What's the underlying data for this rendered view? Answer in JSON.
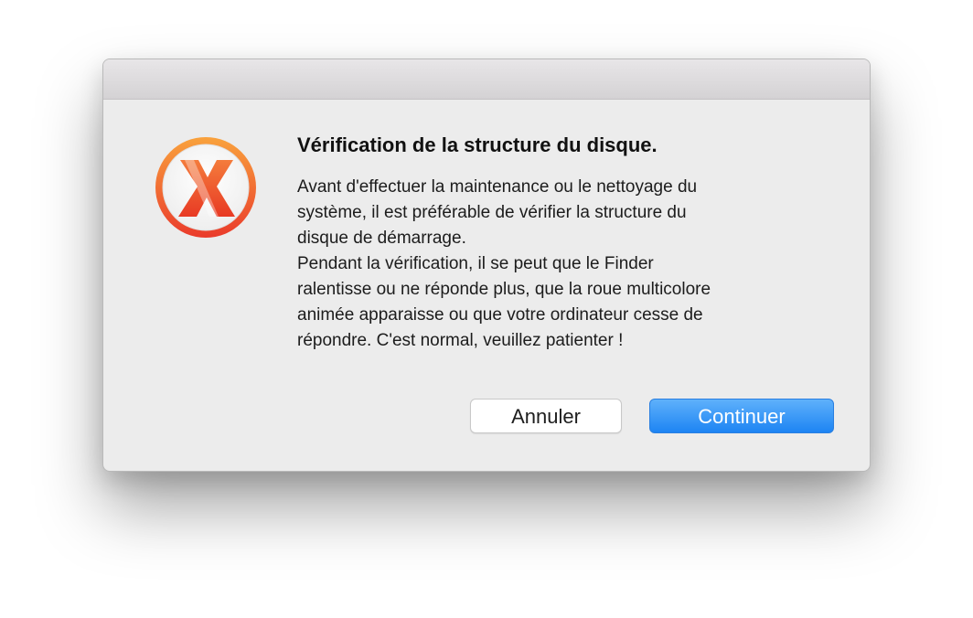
{
  "dialog": {
    "heading": "Vérification de la structure du disque.",
    "paragraph_1": "Avant d'effectuer la maintenance ou le nettoyage du\nsystème, il est préférable de vérifier la structure du\ndisque de démarrage.",
    "paragraph_2": "Pendant la vérification, il se peut que le Finder\nralentisse ou ne réponde plus, que la roue multicolore\nanimée apparaisse ou que votre ordinateur cesse de\nrépondre. C'est normal, veuillez patienter !",
    "icon": "onyx-x-app-icon",
    "buttons": {
      "cancel_label": "Annuler",
      "continue_label": "Continuer"
    }
  },
  "colors": {
    "accent": "#1d84f3",
    "icon_orange": "#f05a28"
  }
}
